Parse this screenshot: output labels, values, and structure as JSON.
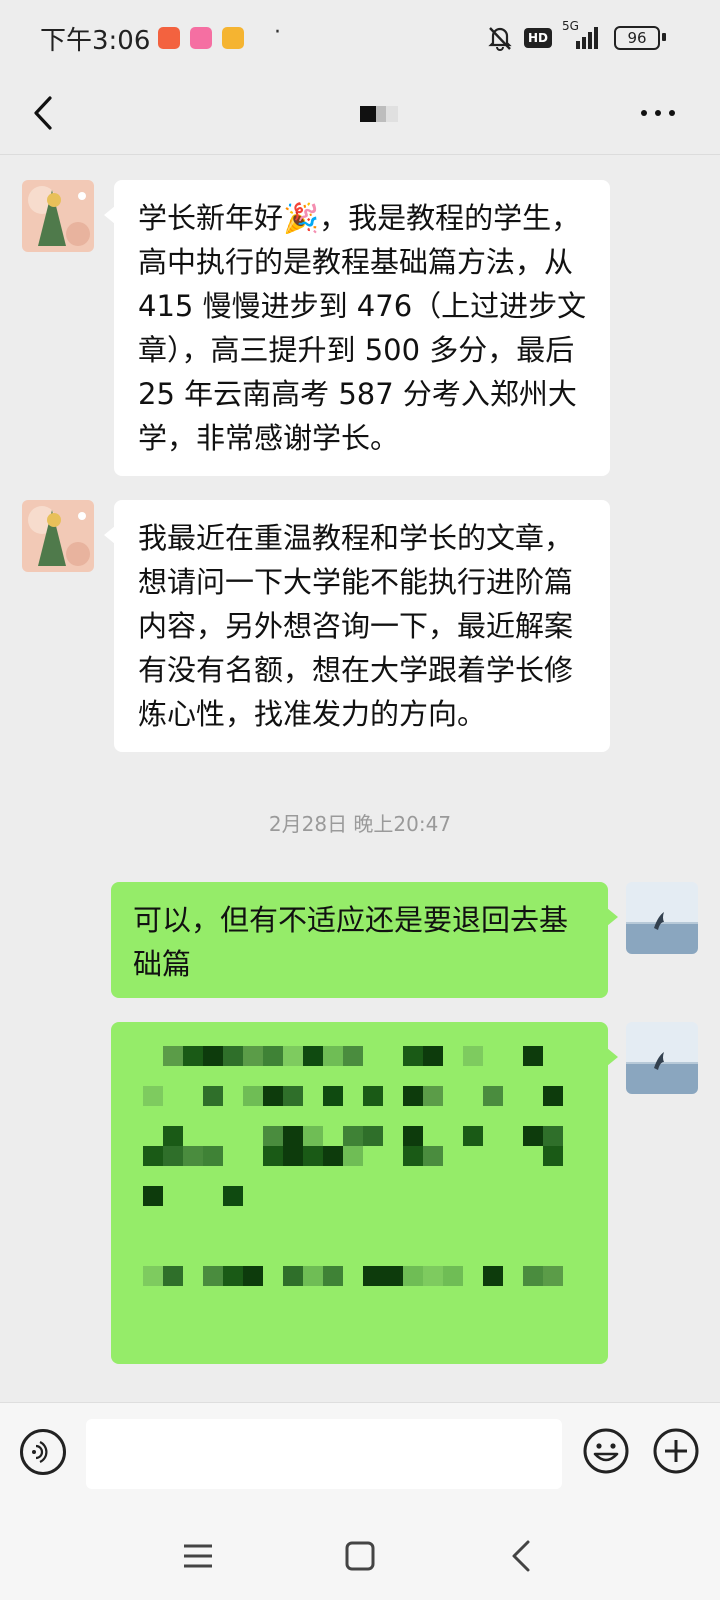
{
  "status_bar": {
    "time": "下午3:06",
    "dot": "·",
    "network": "5G",
    "battery": "96",
    "hd": "HD"
  },
  "header": {
    "title": ""
  },
  "messages": [
    {
      "direction": "incoming",
      "text": "学长新年好🎉，我是教程的学生，高中执行的是教程基础篇方法，从415 慢慢进步到 476（上过进步文章），高三提升到 500 多分，最后 25 年云南高考 587 分考入郑州大学，非常感谢学长。"
    },
    {
      "direction": "incoming",
      "text": "我最近在重温教程和学长的文章，想请问一下大学能不能执行进阶篇内容，另外想咨询一下，最近解案有没有名额，想在大学跟着学长修炼心性，找准发力的方向。"
    },
    {
      "direction": "outgoing",
      "text": "可以，但有不适应还是要退回去基础篇"
    },
    {
      "direction": "outgoing",
      "text": ""
    }
  ],
  "timestamp": "2月28日 晚上20:47",
  "input": {
    "value": "",
    "placeholder": ""
  },
  "icons": {
    "back": "chevron-left-icon",
    "more": "more-dots-icon",
    "voice": "voice-icon",
    "emoji": "emoji-icon",
    "plus": "plus-icon",
    "nav_menu": "menu-icon",
    "nav_home": "home-square-icon",
    "nav_back": "nav-back-icon"
  },
  "colors": {
    "background": "#ededed",
    "outgoing_bubble": "#95ec69",
    "incoming_bubble": "#ffffff",
    "timestamp": "#9a9a9a"
  }
}
